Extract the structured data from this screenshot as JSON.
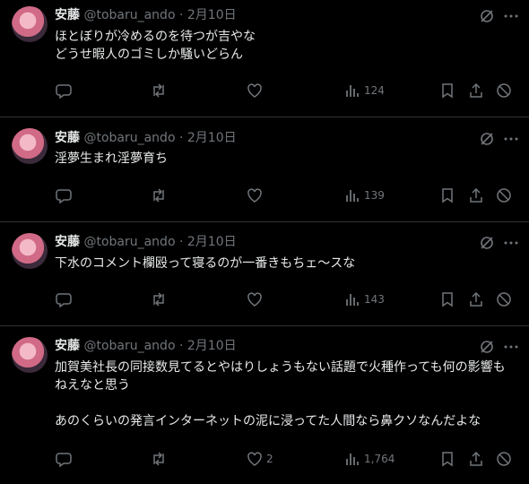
{
  "tweets": [
    {
      "name": "安藤",
      "handle": "@tobaru_ando",
      "separator": "·",
      "date": "2月10日",
      "text": "ほとぼりが冷めるのを待つが吉やな\nどうせ暇人のゴミしか騒いどらん",
      "likes": "",
      "views": "124"
    },
    {
      "name": "安藤",
      "handle": "@tobaru_ando",
      "separator": "·",
      "date": "2月10日",
      "text": "淫夢生まれ淫夢育ち",
      "likes": "",
      "views": "139"
    },
    {
      "name": "安藤",
      "handle": "@tobaru_ando",
      "separator": "·",
      "date": "2月10日",
      "text": "下水のコメント欄殴って寝るのが一番きもちェ～スな",
      "likes": "",
      "views": "143"
    },
    {
      "name": "安藤",
      "handle": "@tobaru_ando",
      "separator": "·",
      "date": "2月10日",
      "text": "加賀美社長の同接数見てるとやはりしょうもない話題で火種作っても何の影響もねえなと思う\n\nあのくらいの発言インターネットの泥に浸ってた人間なら鼻クソなんだよな",
      "likes": "2",
      "views": "1,764"
    }
  ],
  "icons": {
    "reply": "reply-icon",
    "retweet": "retweet-icon",
    "like": "heart-icon",
    "views": "views-icon",
    "bookmark": "bookmark-icon",
    "share": "share-icon",
    "block": "block-icon",
    "grok": "grok-icon",
    "more": "more-icon"
  },
  "colors": {
    "background": "#000000",
    "text": "#e7e9ea",
    "muted": "#71767b",
    "divider": "#2f3336"
  }
}
